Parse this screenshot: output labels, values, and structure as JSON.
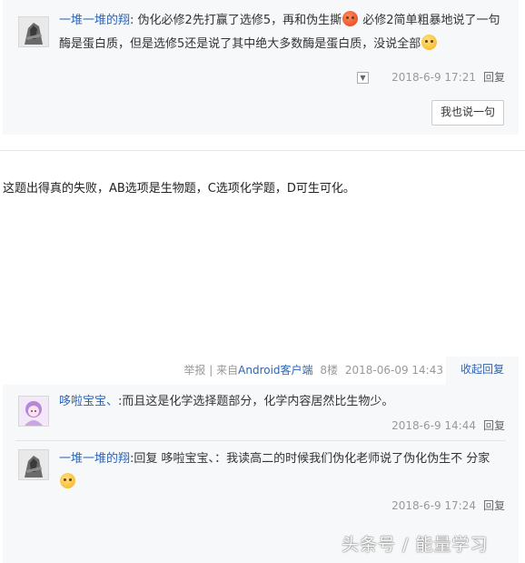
{
  "top_reply": {
    "user": "一堆一堆的翔",
    "colon": ":",
    "text_line1": "伪化必修2先打赢了选修5，再和伪生撕",
    "text_line1_cont": "必修2简单粗暴地说了一",
    "text_line2": "句酶是蛋白质，但是选修5还是说了其中绝大多数酶是蛋白质，没说全部",
    "time": "2018-6-9 17:21",
    "reply_label": "回复",
    "say_button": "我也说一句"
  },
  "post": {
    "body": "这题出得真的失败，AB选项是生物题，C选项化学题，D可生可化。",
    "report_label": "举报",
    "separator": "|",
    "source_prefix": "来自",
    "source_app": "Android客户端",
    "floor": "8楼",
    "datetime": "2018-06-09 14:43",
    "collapse_label": "收起回复"
  },
  "replies": [
    {
      "user": "哆啦宝宝、",
      "colon": ":",
      "text": "而且这是化学选择题部分，化学内容居然比生物少。",
      "time": "2018-6-9 14:44",
      "reply_label": "回复"
    },
    {
      "user": "一堆一堆的翔",
      "colon": ":",
      "text_prefix": "回复 ",
      "reply_to": "哆啦宝宝、",
      "text_line1": "：我读高二的时候我们伪化老师说了伪化伪生不",
      "text_line2": "分家",
      "time": "2018-6-9 17:24",
      "reply_label": "回复"
    }
  ],
  "watermark": "头条号 / 能量学习",
  "icons": [
    "angry-emoji-icon",
    "grin-emoji-icon",
    "dizzy-emoji-icon",
    "dropdown-arrow-icon",
    "report-arrow-icon"
  ],
  "colors": {
    "link": "#2d64b3",
    "panel_bg": "#f7f8fa",
    "meta": "#999999"
  }
}
